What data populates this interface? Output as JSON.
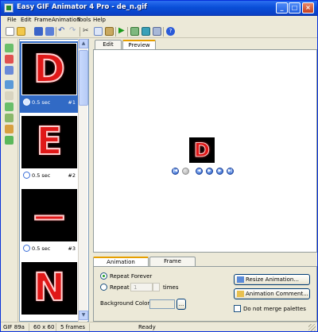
{
  "window": {
    "title": "Easy GIF Animator 4 Pro - de_n.gif",
    "controls": {
      "minimize": "_",
      "maximize": "□",
      "close": "×"
    }
  },
  "menu": [
    "File",
    "Edit",
    "Frame",
    "Animation",
    "Tools",
    "Help"
  ],
  "frames": [
    {
      "letter": "D",
      "time": "0.5 sec",
      "number": "#1",
      "selected": true
    },
    {
      "letter": "E",
      "time": "0.5 sec",
      "number": "#2",
      "selected": false
    },
    {
      "letter": "—",
      "time": "0.5 sec",
      "number": "#3",
      "selected": false
    },
    {
      "letter": "N",
      "time": "",
      "number": "",
      "selected": false
    }
  ],
  "editor_tabs": {
    "edit": "Edit",
    "preview": "Preview",
    "active": "Preview"
  },
  "preview": {
    "letter": "D"
  },
  "property_tabs": {
    "animation": "Animation Properties",
    "frame": "Frame Properties",
    "active": "Animation Properties"
  },
  "animation_properties": {
    "repeat_forever": "Repeat Forever",
    "repeat": "Repeat",
    "repeat_count": "1",
    "times": "times",
    "background_color": "Background Color:",
    "browse": "...",
    "resize_button": "Resize Animation...",
    "comment_button": "Animation Comment...",
    "merge_palettes": "Do not merge palettes"
  },
  "status": {
    "format": "GIF 89a",
    "size": "60 x 60",
    "frames": "5 frames",
    "state": "Ready"
  },
  "colors": {
    "accent": "#316ac5",
    "titlebar": "#0a4fd8",
    "letter": "#e01818"
  }
}
